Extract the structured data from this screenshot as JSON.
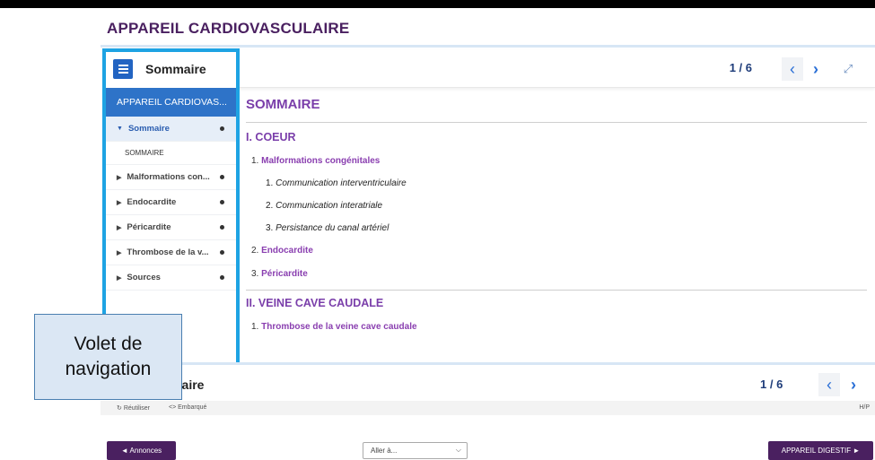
{
  "app": {
    "title": "APPAREIL CARDIOVASCULAIRE"
  },
  "toolbar": {
    "page_counter": "1 / 6",
    "prev_icon": "chevron-left-icon",
    "next_icon": "chevron-right-icon",
    "fullscreen_icon": "expand-icon"
  },
  "sidebar": {
    "title": "Sommaire",
    "menu_icon": "hamburger-icon",
    "active_heading": "APPAREIL CARDIOVAS...",
    "items": [
      {
        "label": "Sommaire",
        "expanded": true
      },
      {
        "label": "SOMMAIRE",
        "sub": true
      },
      {
        "label": "Malformations con..."
      },
      {
        "label": "Endocardite"
      },
      {
        "label": "Péricardite"
      },
      {
        "label": "Thrombose de la v..."
      },
      {
        "label": "Sources"
      }
    ]
  },
  "content": {
    "heading": "SOMMAIRE",
    "sections": [
      {
        "title": "I. COEUR",
        "entries": [
          {
            "num": "1.",
            "label": "Malformations congénitales",
            "children": [
              {
                "num": "1.",
                "label": "Communication interventriculaire"
              },
              {
                "num": "2.",
                "label": "Communication interatriale"
              },
              {
                "num": "3.",
                "label": "Persistance du canal artériel"
              }
            ]
          },
          {
            "num": "2.",
            "label": "Endocardite"
          },
          {
            "num": "3.",
            "label": "Péricardite"
          }
        ]
      },
      {
        "title": "II. VEINE CAVE CAUDALE",
        "entries": [
          {
            "num": "1.",
            "label": "Thrombose de la veine cave caudale"
          }
        ]
      }
    ]
  },
  "bottom_bar": {
    "title": "naire",
    "page_counter": "1 / 6"
  },
  "footer": {
    "reuse": "Réutiliser",
    "embed": "<> Embarqué",
    "hp": "H/P"
  },
  "callout": {
    "line1": "Volet de",
    "line2": "navigation"
  },
  "nav": {
    "prev_chapter": "◄ Annonces",
    "goto_placeholder": "Aller à...",
    "next_chapter": "APPAREIL DIGESTIF ►"
  },
  "colors": {
    "accent": "#2e73c8",
    "brand": "#4a2060",
    "link": "#7a3eaa",
    "highlight": "#1ea3e3"
  }
}
